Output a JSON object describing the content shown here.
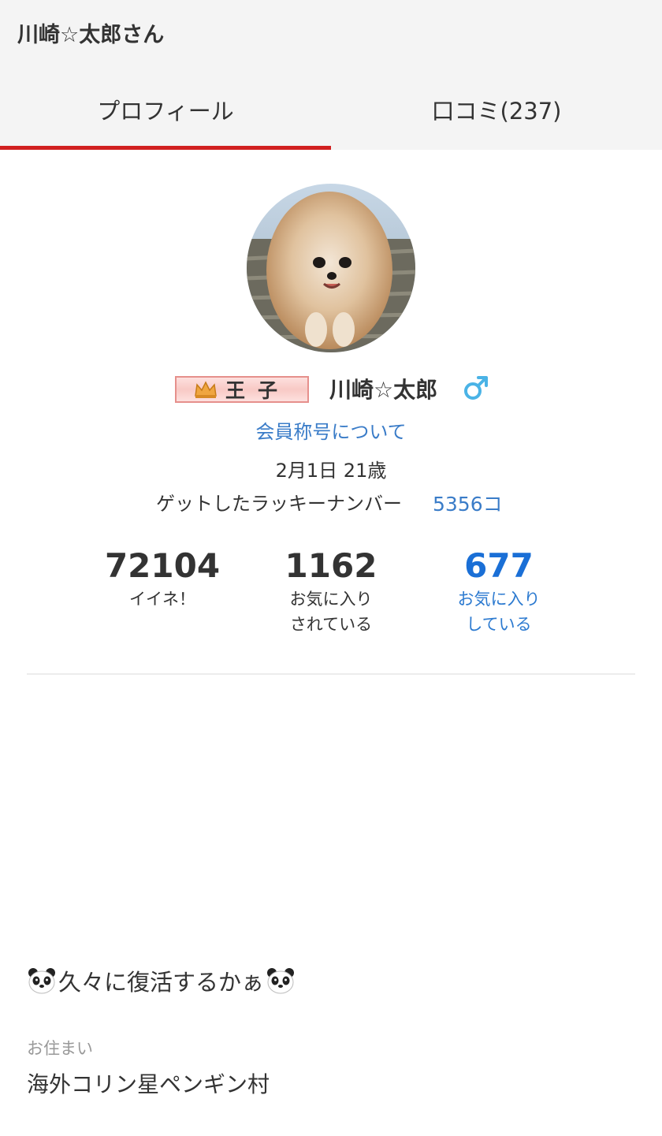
{
  "header": {
    "title": "川崎☆太郎さん",
    "tabs": [
      {
        "label": "プロフィール",
        "active": true
      },
      {
        "label": "口コミ(237)",
        "active": false
      }
    ],
    "accent_color": "#d12020"
  },
  "profile": {
    "avatar_icon": "pomeranian-dog-photo",
    "rank_badge": {
      "icon": "crown-icon",
      "label": "王子"
    },
    "name": "川崎☆太郎",
    "gender_icon": "male-icon",
    "title_link": "会員称号について",
    "birthday": "2月1日 21歳",
    "lucky_number_label": "ゲットしたラッキーナンバー",
    "lucky_number_count": "5356コ"
  },
  "stats": [
    {
      "value": "72104",
      "label": "イイネ！"
    },
    {
      "value": "1162",
      "label": "お気に入り\nされている"
    },
    {
      "value": "677",
      "label": "お気に入り\nしている",
      "link": true
    }
  ],
  "comment": {
    "icon_left": "panda-icon",
    "text": "久々に復活するかぁ",
    "icon_right": "panda-icon"
  },
  "residence": {
    "label": "お住まい",
    "value": "海外コリン星ペンギン村"
  }
}
